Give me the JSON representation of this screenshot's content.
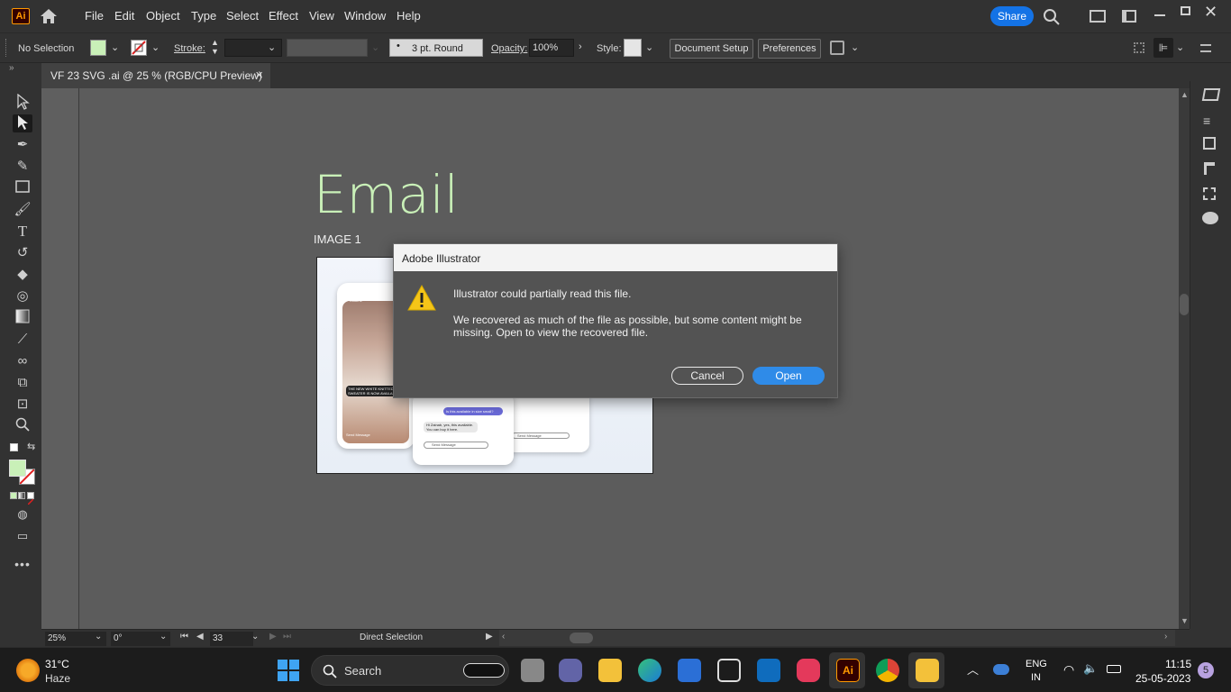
{
  "app": {
    "logo": "Ai",
    "accent": "#ff9a00",
    "logo_bg": "#330000"
  },
  "menu": {
    "items": [
      "File",
      "Edit",
      "Object",
      "Type",
      "Select",
      "Effect",
      "View",
      "Window",
      "Help"
    ],
    "share_label": "Share"
  },
  "control_bar": {
    "selection": "No Selection",
    "stroke_label": "Stroke:",
    "brush": "3 pt. Round",
    "opacity_label": "Opacity:",
    "opacity_value": "100%",
    "style_label": "Style:",
    "document_setup": "Document Setup",
    "preferences": "Preferences",
    "fill_color": "#c9f0b8"
  },
  "tab": {
    "title": "VF 23 SVG .ai @ 25 % (RGB/CPU Preview)",
    "close": "×"
  },
  "artboard": {
    "heading": "Email",
    "heading_color": "#c9f0b8",
    "label": "IMAGE 1",
    "preview_text": {
      "caption": "THE NEW WHITE KNITTED SWEATER IS NOW AVAILABLE",
      "send_msg": "Send Message",
      "bubble1": "Is this available in size small?",
      "bubble2": "Hi Zainab, yes, this available. You can buy it here.",
      "send_msg2": "Send Message",
      "send_msg3": "Send Message",
      "handle": "elkaknit"
    }
  },
  "dialog": {
    "title": "Adobe Illustrator",
    "headline": "Illustrator could partially read this file.",
    "body": "We recovered as much of the file as possible, but some content might be missing. Open to view the recovered file.",
    "cancel": "Cancel",
    "open": "Open",
    "open_color": "#2f8be8"
  },
  "status_bar": {
    "zoom": "25%",
    "rotation": "0°",
    "artboard": "33",
    "tool": "Direct Selection"
  },
  "taskbar": {
    "weather_temp": "31°C",
    "weather_desc": "Haze",
    "search_label": "Search",
    "lang": "ENG",
    "region": "IN",
    "time": "11:15",
    "date": "25-05-2023",
    "notif_count": "5"
  }
}
